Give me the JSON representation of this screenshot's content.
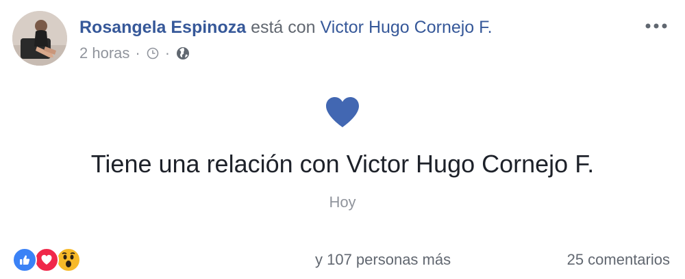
{
  "post": {
    "author": "Rosangela Espinoza",
    "verb": "está con",
    "tagged_person": "Victor Hugo Cornejo F.",
    "time": "2 horas",
    "separator": "·",
    "icons": {
      "clock": "clock-icon",
      "audience": "globe-icon",
      "more": "more-options-icon",
      "heart": "heart-icon"
    }
  },
  "life_event": {
    "title": "Tiene una relación con Victor Hugo Cornejo F.",
    "date": "Hoy",
    "icon_color": "#4267b2"
  },
  "footer": {
    "reactions": [
      "like-reaction-icon",
      "love-reaction-icon",
      "wow-reaction-icon"
    ],
    "people_text": "y 107 personas más",
    "comments_text": "25 comentarios"
  },
  "colors": {
    "link": "#365899",
    "secondary_text": "#90949c",
    "primary_text": "#1d2129",
    "like": "#3b82f6",
    "love": "#f0284a",
    "wow": "#f7b928"
  }
}
